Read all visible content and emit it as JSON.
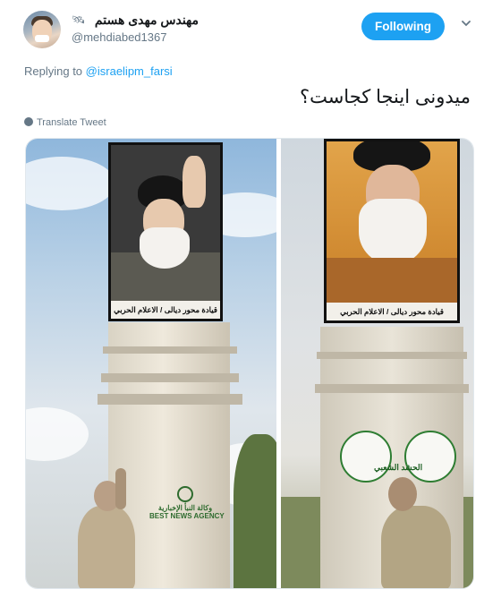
{
  "tweet": {
    "display_name": "مهندس مهدی هستم",
    "display_name_emoji": "🛰",
    "handle": "@mehdiabed1367",
    "follow_label": "Following",
    "replying_prefix": "Replying to",
    "replying_to": "@israelipm_farsi",
    "text": "میدونی اینجا کجاست؟",
    "translate_label": "Translate Tweet"
  },
  "media": {
    "left_poster_caption": "قيادة محور ديالى / الاعلام الحربي",
    "right_poster_caption": "قيادة محور ديالى / الاعلام الحربي",
    "emblem_text": "الحشد الشعبي",
    "wall_sign_arabic": "وكالة النبأ الإخبارية",
    "wall_sign_english": "BEST NEWS AGENCY"
  },
  "colors": {
    "accent": "#1da1f2",
    "text_primary": "#14171a",
    "text_secondary": "#657786"
  },
  "icons": {
    "caret": "chevron-down-icon",
    "translate": "globe-icon"
  }
}
